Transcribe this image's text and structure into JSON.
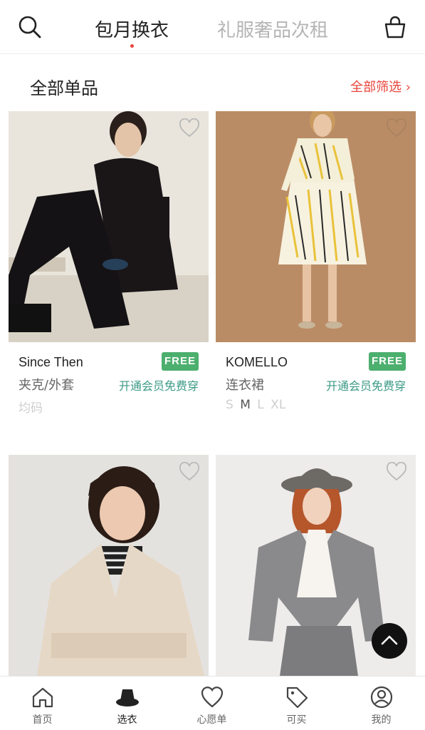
{
  "header": {
    "tab_active": "包月换衣",
    "tab_inactive": "礼服奢品次租",
    "search_icon": "search-icon",
    "bag_icon": "shopping-bag-icon"
  },
  "section": {
    "title": "全部单品",
    "filter_label": "全部筛选 ›"
  },
  "colors": {
    "accent_red": "#e8453c",
    "free_green": "#4caf6e",
    "member_teal": "#3b9a86"
  },
  "products": [
    {
      "brand": "Since Then",
      "badge": "FREE",
      "category": "夹克/外套",
      "member_text": "开通会员免费穿",
      "size_text": "均码"
    },
    {
      "brand": "KOMELLO",
      "badge": "FREE",
      "category": "连衣裙",
      "member_text": "开通会员免费穿",
      "sizes": [
        "S",
        "M",
        "L",
        "XL"
      ],
      "sizes_available": [
        "M"
      ]
    },
    {
      "brand": "",
      "badge": ""
    },
    {
      "brand": "",
      "badge": ""
    }
  ],
  "bottom_nav": [
    {
      "label": "首页",
      "icon": "home-icon"
    },
    {
      "label": "选衣",
      "icon": "hat-icon",
      "active": true
    },
    {
      "label": "心愿单",
      "icon": "heart-icon"
    },
    {
      "label": "可买",
      "icon": "price-tag-icon"
    },
    {
      "label": "我的",
      "icon": "user-icon"
    }
  ]
}
